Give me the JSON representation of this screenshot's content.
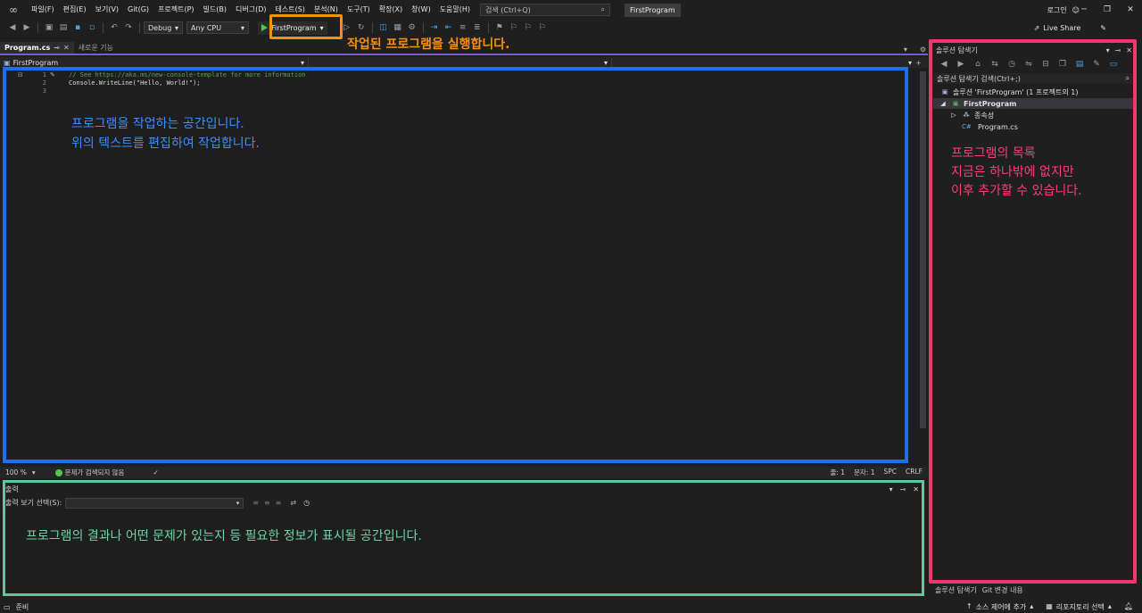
{
  "window": {
    "menu": [
      "파일(F)",
      "편집(E)",
      "보기(V)",
      "Git(G)",
      "프로젝트(P)",
      "빌드(B)",
      "디버그(D)",
      "테스트(S)",
      "분석(N)",
      "도구(T)",
      "확장(X)",
      "창(W)",
      "도움말(H)"
    ],
    "search_placeholder": "검색 (Ctrl+Q)",
    "project_title": "FirstProgram",
    "login": "로그인",
    "live_share": "Live Share"
  },
  "toolbar": {
    "configuration": "Debug",
    "platform": "Any CPU",
    "run_target": "FirstProgram"
  },
  "editor": {
    "tabs": [
      {
        "label": "Program.cs",
        "active": true
      },
      {
        "label": "새로운 기능",
        "active": false
      }
    ],
    "nav_scope": "FirstProgram",
    "line_numbers": [
      "1",
      "2",
      "3"
    ],
    "code_lines": [
      "// See https://aka.ms/new-console-template for more information",
      "Console.WriteLine(\"Hello, World!\");",
      ""
    ]
  },
  "editor_status": {
    "zoom": "100 %",
    "issues": "문제가 검색되지 않음",
    "line": "줄: 1",
    "char": "문자: 1",
    "spc": "SPC",
    "eol": "CRLF"
  },
  "output": {
    "title": "출력",
    "show_output_label": "출력 보기 선택(S):"
  },
  "solution_explorer": {
    "title": "솔루션 탐색기",
    "search_label": "솔루션 탐색기 검색(Ctrl+;)",
    "solution_row": "솔루션 'FirstProgram' (1 프로젝트의 1)",
    "project_row": "FirstProgram",
    "dependencies_row": "종속성",
    "file_row": "Program.cs",
    "bottom_tabs": [
      "솔루션 탐색기",
      "Git 변경 내용"
    ]
  },
  "statusbar": {
    "ready": "준비",
    "add_source_control": "소스 제어에 추가",
    "select_repo": "리포지토리 선택"
  },
  "annotations": {
    "run": "작업된 프로그램을 실행합니다.",
    "editor_line1": "프로그램을 작업하는 공간입니다.",
    "editor_line2": "위의 텍스트를 편집하여 작업합니다.",
    "output": "프로그램의 결과나 어떤 문제가 있는지 등 필요한 정보가 표시될 공간입니다.",
    "explorer_line1": "프로그램의 목록",
    "explorer_line2": "지금은 하나밖에 없지만",
    "explorer_line3": "이후 추가할 수 있습니다."
  },
  "colors": {
    "run_frame": "#f7900f",
    "editor_frame": "#1f6fe8",
    "output_frame": "#5ec79c",
    "explorer_frame": "#f0386f"
  }
}
